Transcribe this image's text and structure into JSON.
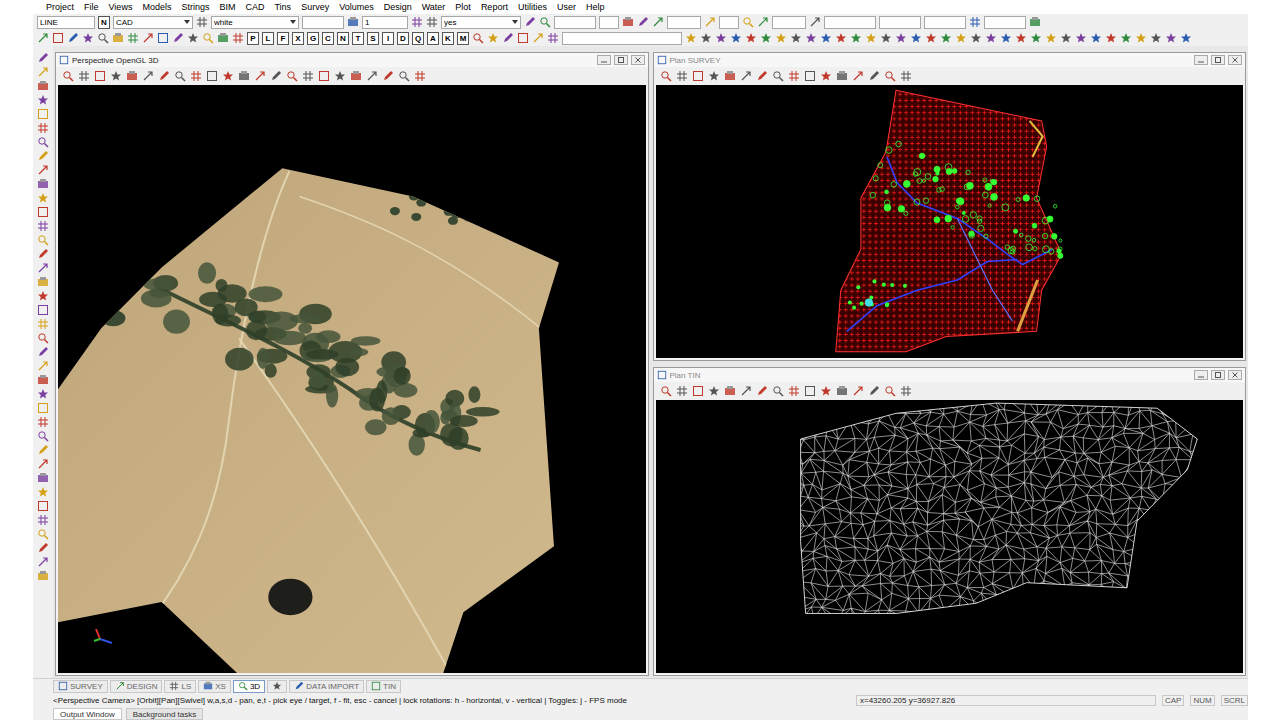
{
  "window": {
    "menu": [
      "Project",
      "File",
      "Views",
      "Models",
      "Strings",
      "BIM",
      "CAD",
      "Tins",
      "Survey",
      "Volumes",
      "Design",
      "Water",
      "Plot",
      "Report",
      "Utilities",
      "User",
      "Help"
    ]
  },
  "toolbar_fields": [
    {
      "value": "LINE",
      "kind": "text"
    },
    {
      "value": "N",
      "kind": "button"
    },
    {
      "value": "CAD",
      "kind": "combo"
    },
    {
      "value": "white",
      "kind": "combo"
    },
    {
      "value": "1",
      "kind": "text"
    },
    {
      "value": "yes",
      "kind": "combo"
    }
  ],
  "toolbar_letters": [
    "P",
    "L",
    "F",
    "X",
    "G",
    "C",
    "N",
    "T",
    "S",
    "I",
    "D",
    "Q",
    "A",
    "K",
    "M"
  ],
  "views": [
    {
      "title": "Plan SURVEY",
      "kind": "survey",
      "active": false
    },
    {
      "title": "Plan TIN",
      "kind": "tin",
      "active": false
    },
    {
      "title": "Perspective OpenGL 3D",
      "kind": "perspective",
      "active": true
    }
  ],
  "tabs": [
    {
      "label": "SURVEY",
      "selected": false
    },
    {
      "label": "DESIGN",
      "selected": false
    },
    {
      "label": "LS",
      "selected": false
    },
    {
      "label": "XS",
      "selected": false
    },
    {
      "label": "3D",
      "selected": true
    },
    {
      "label": "",
      "selected": false
    },
    {
      "label": "DATA IMPORT",
      "selected": false
    },
    {
      "label": "TIN",
      "selected": false
    }
  ],
  "status": {
    "prompt": "<Perspective Camera> [Orbit][Pan][Swivel] w,a,s,d - pan, e,t - pick eye / target, f - fit, esc - cancel | lock rotations: h - horizontal, v - vertical | Toggles: j - FPS mode",
    "coords": "x=43260.205 y=36927.826",
    "indicators": [
      "CAP",
      "NUM",
      "SCRL"
    ]
  },
  "output_tabs": [
    {
      "label": "Output Window",
      "selected": true
    },
    {
      "label": "Background tasks",
      "selected": false
    }
  ]
}
